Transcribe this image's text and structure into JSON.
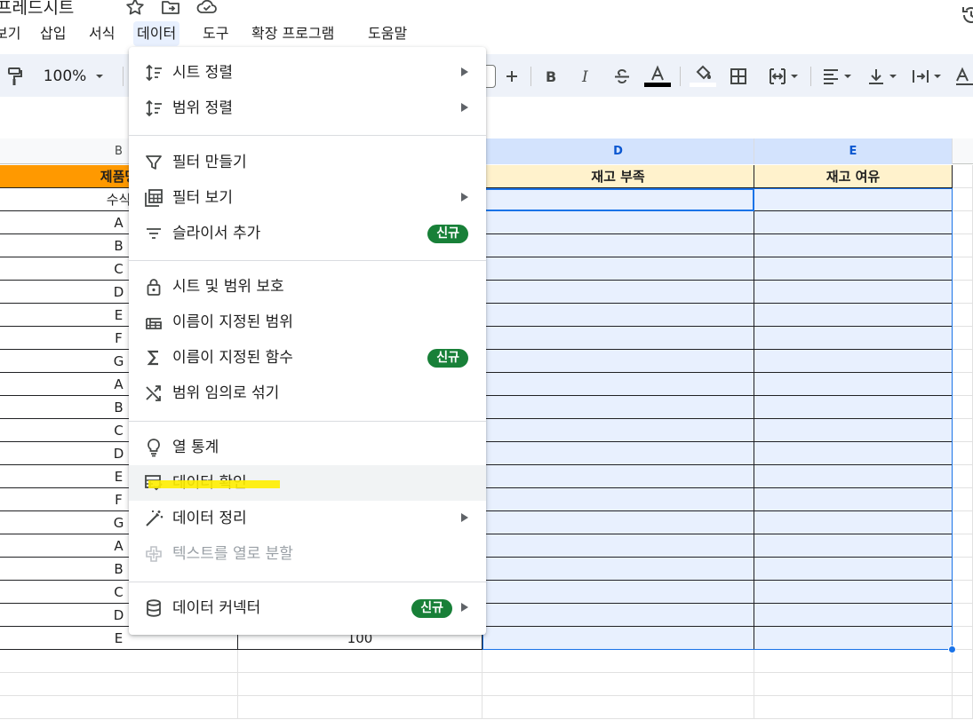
{
  "title": {
    "doc_name": "프레드시트"
  },
  "menu": {
    "items": [
      "보기",
      "삽입",
      "서식",
      "데이터",
      "도구",
      "확장 프로그램",
      "도움말"
    ],
    "active": "데이터"
  },
  "toolbar": {
    "zoom": "100%"
  },
  "grid": {
    "columns": [
      "B",
      "D",
      "E"
    ],
    "header_row": {
      "b": "제품명",
      "d": "재고 부족",
      "e": "재고 여유"
    },
    "row2_b": "수식",
    "b_values": [
      "A",
      "B",
      "C",
      "D",
      "E",
      "F",
      "G",
      "A",
      "B",
      "C",
      "D",
      "E",
      "F",
      "G",
      "A",
      "B",
      "C",
      "D",
      "E"
    ],
    "last_c_value": "100"
  },
  "dropdown": {
    "items": [
      {
        "label": "시트 정렬",
        "icon": "sort-icon",
        "submenu": true
      },
      {
        "label": "범위 정렬",
        "icon": "sort-range-icon",
        "submenu": true
      },
      {
        "label": "필터 만들기",
        "icon": "filter-icon"
      },
      {
        "label": "필터 보기",
        "icon": "filter-views-icon",
        "submenu": true
      },
      {
        "label": "슬라이서 추가",
        "icon": "slicer-icon",
        "badge": "신규"
      },
      {
        "label": "시트 및 범위 보호",
        "icon": "lock-icon"
      },
      {
        "label": "이름이 지정된 범위",
        "icon": "named-range-icon"
      },
      {
        "label": "이름이 지정된 함수",
        "icon": "sigma-icon",
        "badge": "신규"
      },
      {
        "label": "범위 임의로 섞기",
        "icon": "shuffle-icon"
      },
      {
        "label": "열 통계",
        "icon": "lightbulb-icon"
      },
      {
        "label": "데이터 확인",
        "icon": "data-validation-icon"
      },
      {
        "label": "데이터 정리",
        "icon": "magic-wand-icon",
        "submenu": true
      },
      {
        "label": "텍스트를 열로 분할",
        "icon": "split-icon",
        "disabled": true
      },
      {
        "label": "데이터 커넥터",
        "icon": "database-icon",
        "badge": "신규",
        "submenu": true
      }
    ]
  },
  "colors": {
    "accent": "#1a73e8",
    "orange_header": "#ff9900",
    "yellow_header": "#fff2cc",
    "badge": "#188038",
    "highlight": "#ffee00"
  }
}
